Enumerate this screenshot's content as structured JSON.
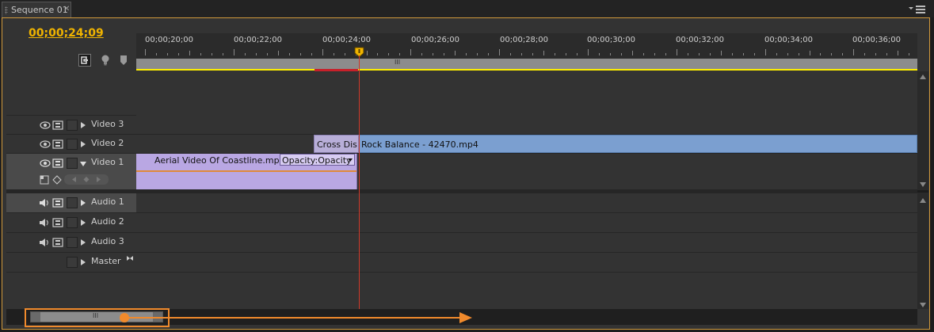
{
  "window": {
    "tab_title": "Sequence 01"
  },
  "header": {
    "timecode": "00;00;24;09"
  },
  "ruler": {
    "labels": [
      "00;00;20;00",
      "00;00;22;00",
      "00;00;24;00",
      "00;00;26;00",
      "00;00;28;00",
      "00;00;30;00",
      "00;00;32;00",
      "00;00;34;00",
      "00;00;36;00"
    ],
    "work_area_grip": "III"
  },
  "tracks": {
    "video3": "Video 3",
    "video2": "Video 2",
    "video1": "Video 1",
    "audio1": "Audio 1",
    "audio2": "Audio 2",
    "audio3": "Audio 3",
    "master": "Master"
  },
  "clips": {
    "transition": "Cross Dis",
    "rock": "Rock Balance - 42470.mp4",
    "aerial": "Aerial Video Of Coastline.mp4",
    "opacity": "Opacity:Opacity"
  },
  "scrollbar": {
    "grip": "III"
  },
  "colors": {
    "accent_timecode": "#f0b400",
    "clip_blue": "#7b9fd0",
    "clip_purple": "#b9a7e3",
    "annotation_orange": "#f08a2c",
    "playhead": "#d03a2a"
  }
}
